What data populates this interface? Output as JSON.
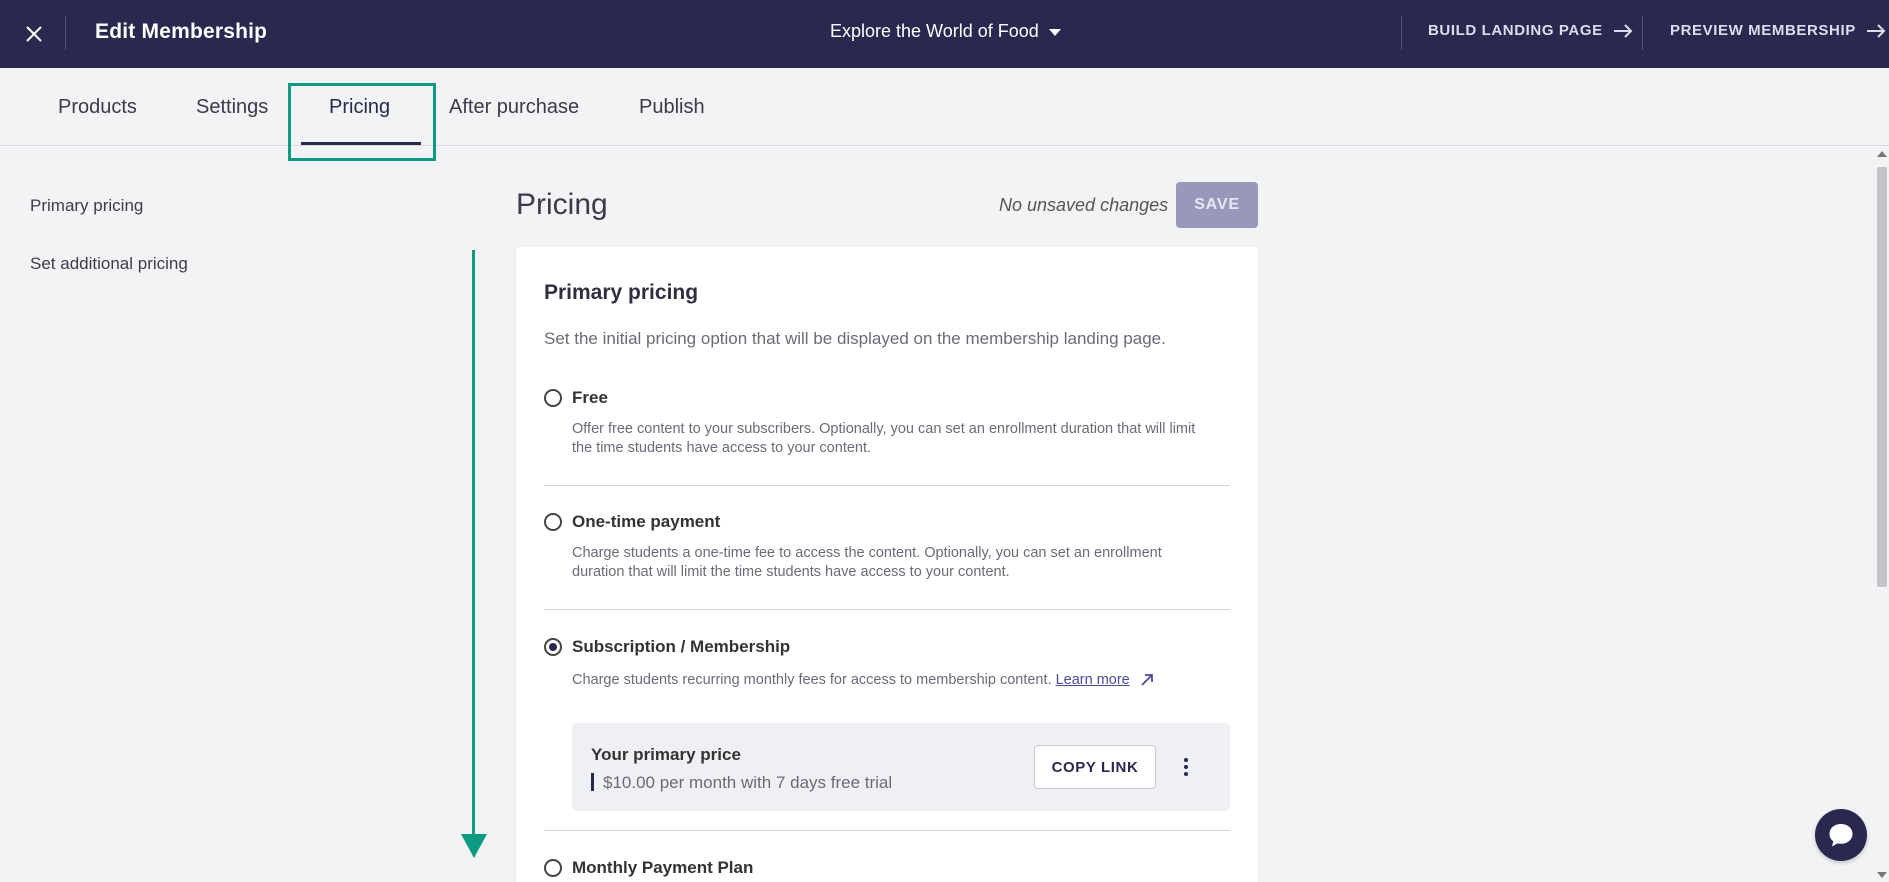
{
  "topbar": {
    "title": "Edit Membership",
    "product_name": "Explore the World of Food",
    "build_landing_page": "BUILD LANDING PAGE",
    "preview_membership": "PREVIEW MEMBERSHIP"
  },
  "tabs": [
    {
      "label": "Products",
      "active": false
    },
    {
      "label": "Settings",
      "active": false
    },
    {
      "label": "Pricing",
      "active": true
    },
    {
      "label": "After purchase",
      "active": false
    },
    {
      "label": "Publish",
      "active": false
    }
  ],
  "leftnav": {
    "items": [
      {
        "label": "Primary pricing"
      },
      {
        "label": "Set additional pricing"
      }
    ]
  },
  "header": {
    "title": "Pricing",
    "status": "No unsaved changes",
    "save_label": "SAVE"
  },
  "card": {
    "title": "Primary pricing",
    "subtitle": "Set the initial pricing option that will be displayed on the membership landing page.",
    "options": [
      {
        "label": "Free",
        "description": "Offer free content to your subscribers. Optionally, you can set an enrollment duration that will limit the time students have access to your content.",
        "selected": false
      },
      {
        "label": "One-time payment",
        "description": "Charge students a one-time fee to access the content. Optionally, you can set an enrollment duration that will limit the time students have access to your content.",
        "selected": false
      },
      {
        "label": "Subscription / Membership",
        "description": "Charge students recurring monthly fees for access to membership content.",
        "link_text": "Learn more",
        "selected": true
      },
      {
        "label": "Monthly Payment Plan",
        "selected": false
      }
    ],
    "primary_price": {
      "title": "Your primary price",
      "text": "$10.00 per month with 7 days free trial",
      "copy_label": "COPY LINK"
    }
  },
  "colors": {
    "topbar_bg": "#29284f",
    "accent_annotation": "#0e9a82",
    "save_disabled": "#9998ba"
  }
}
